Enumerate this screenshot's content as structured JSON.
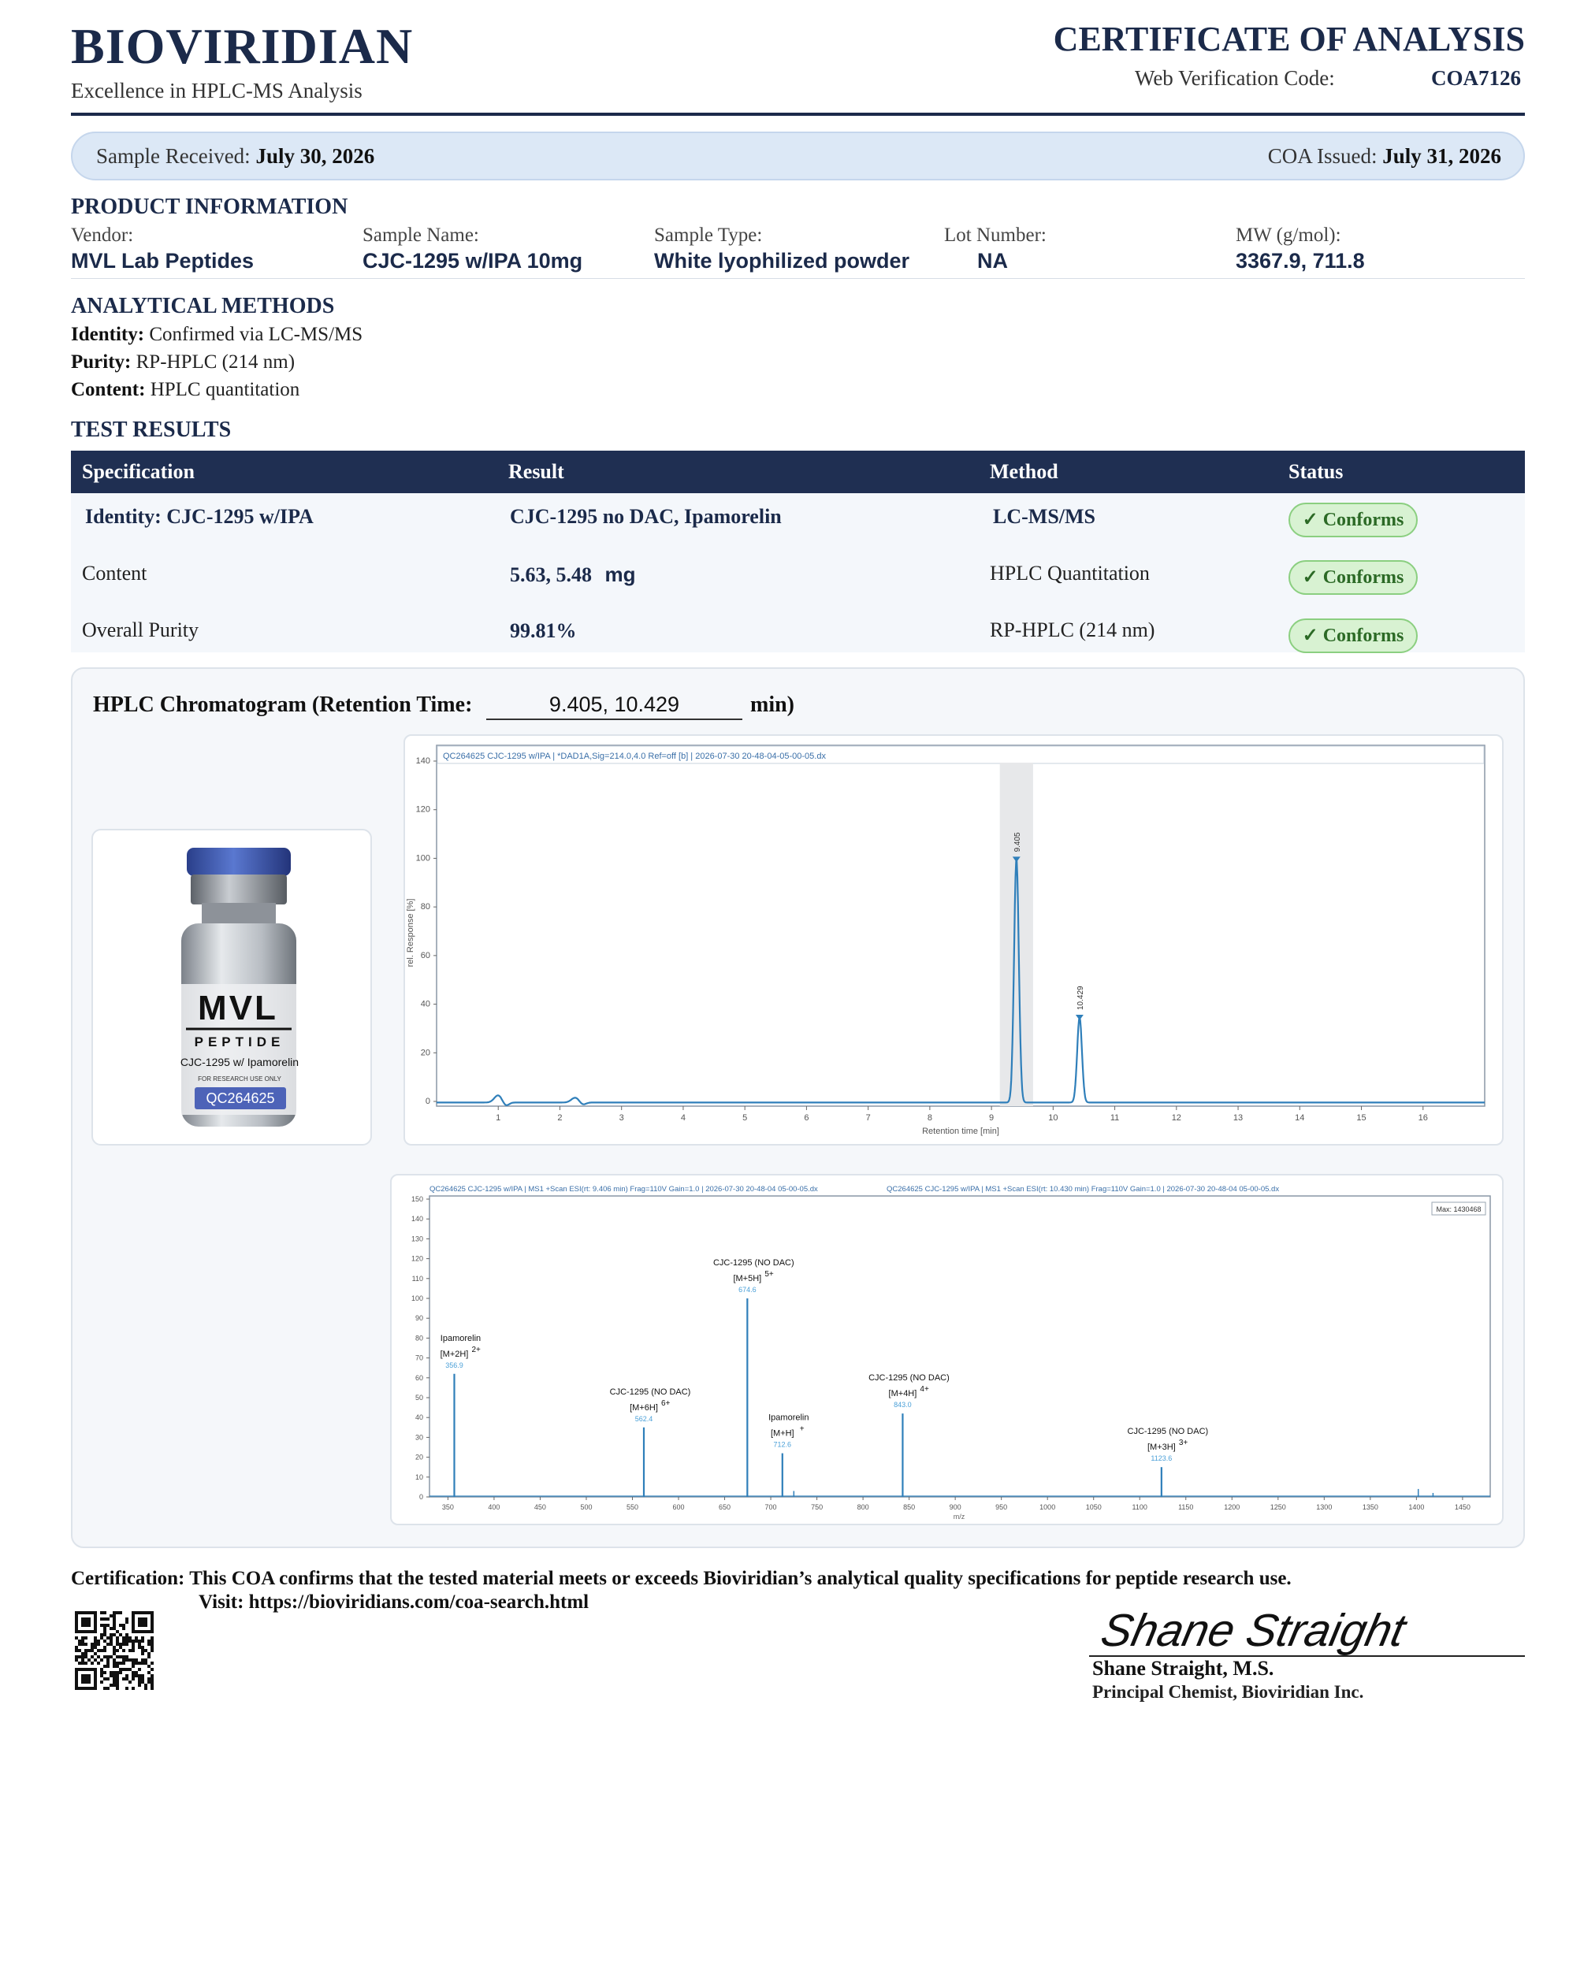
{
  "header": {
    "brand": "BIOVIRIDIAN",
    "tagline": "Excellence in HPLC-MS Analysis",
    "doc_title": "CERTIFICATE OF ANALYSIS",
    "verification_label": "Web Verification Code:",
    "verification_code": "COA7126"
  },
  "dates": {
    "received_label": "Sample Received:",
    "received_value": "July 30, 2026",
    "issued_label": "COA Issued:",
    "issued_value": "July 31, 2026"
  },
  "product_info": {
    "heading": "PRODUCT INFORMATION",
    "fields": [
      {
        "label": "Vendor:",
        "value": "MVL Lab Peptides"
      },
      {
        "label": "Sample Name:",
        "value": "CJC-1295 w/IPA 10mg"
      },
      {
        "label": "Sample Type:",
        "value": "White lyophilized powder"
      },
      {
        "label": "Lot Number:",
        "value": "NA"
      },
      {
        "label": "MW (g/mol):",
        "value": "3367.9, 711.8"
      }
    ]
  },
  "methods": {
    "heading": "ANALYTICAL METHODS",
    "items": [
      {
        "label": "Identity:",
        "value": "Confirmed via LC-MS/MS"
      },
      {
        "label": "Purity:",
        "value": "RP-HPLC (214 nm)"
      },
      {
        "label": "Content:",
        "value": "HPLC quantitation"
      }
    ]
  },
  "results": {
    "heading": "TEST RESULTS",
    "columns": [
      "Specification",
      "Result",
      "Method",
      "Status"
    ],
    "rows": [
      {
        "spec": "Identity:  CJC-1295 w/IPA",
        "result": "CJC-1295 no DAC, Ipamorelin",
        "unit": "",
        "method": "LC-MS/MS",
        "status": "✓ Conforms"
      },
      {
        "spec": "Content",
        "result": "5.63, 5.48",
        "unit": "mg",
        "method": "HPLC Quantitation",
        "status": "✓ Conforms"
      },
      {
        "spec": "Overall Purity",
        "result": "99.81%",
        "unit": "",
        "method": "RP-HPLC (214 nm)",
        "status": "✓ Conforms"
      }
    ]
  },
  "chromatogram": {
    "title": "HPLC Chromatogram (Retention Time:",
    "retention_time": "9.405, 10.429",
    "unit": "min)"
  },
  "vial": {
    "brand": "MVL",
    "sub": "PEPTIDE",
    "name": "CJC-1295 w/ Ipamorelin",
    "note": "FOR RESEARCH USE ONLY",
    "lot": "QC264625"
  },
  "hplc_plot": {
    "header": "QC264625 CJC-1295 w/IPA | *DAD1A,Sig=214.0,4.0 Ref=off [b] | 2026-07-30 20-48-04-05-00-05.dx",
    "ylabel": "rel. Response [%]",
    "xlabel": "Retention time [min]",
    "peak_labels": [
      "9.405",
      "10.429"
    ]
  },
  "ms_plot": {
    "header_left": "QC264625 CJC-1295 w/IPA | MS1 +Scan ESI(rt: 9.406 min) Frag=110V Gain=1.0 | 2026-07-30 20-48-04 05-00-05.dx",
    "header_right": "QC264625 CJC-1295 w/IPA | MS1 +Scan ESI(rt: 10.430 min) Frag=110V Gain=1.0 | 2026-07-30 20-48-04 05-00-05.dx",
    "max_label": "Max: 1430468",
    "xlabel": "m/z",
    "peaks": [
      {
        "name": "Ipamorelin",
        "ion": "[M+2H]",
        "charge": "2+",
        "mz_label": "356.9"
      },
      {
        "name": "CJC-1295 (NO DAC)",
        "ion": "[M+6H]",
        "charge": "6+",
        "mz_label": "562.4"
      },
      {
        "name": "CJC-1295 (NO DAC)",
        "ion": "[M+5H]",
        "charge": "5+",
        "mz_label": "674.6"
      },
      {
        "name": "Ipamorelin",
        "ion": "[M+H]",
        "charge": "+",
        "mz_label": "712.6"
      },
      {
        "name": "CJC-1295 (NO DAC)",
        "ion": "[M+4H]",
        "charge": "4+",
        "mz_label": "843.0"
      },
      {
        "name": "CJC-1295 (NO DAC)",
        "ion": "[M+3H]",
        "charge": "3+",
        "mz_label": "1123.6"
      }
    ]
  },
  "chart_data": [
    {
      "type": "line",
      "xlabel": "Retention time [min]",
      "ylabel": "rel. Response [%]",
      "xlim": [
        0,
        17
      ],
      "ylim": [
        0,
        140
      ],
      "xticks": [
        1,
        2,
        3,
        4,
        5,
        6,
        7,
        8,
        9,
        10,
        11,
        12,
        13,
        14,
        15,
        16
      ],
      "yticks": [
        0,
        20,
        40,
        60,
        80,
        100,
        120,
        140
      ],
      "peaks": [
        {
          "x": 9.405,
          "y": 100,
          "label": "9.405"
        },
        {
          "x": 10.429,
          "y": 35,
          "label": "10.429"
        }
      ],
      "minor_features": [
        {
          "x": 1.0,
          "y": 3
        },
        {
          "x": 2.25,
          "y": 2
        }
      ],
      "baseline": 1.5
    },
    {
      "type": "bar",
      "xlabel": "m/z",
      "xlim": [
        330,
        1480
      ],
      "ylim": [
        0,
        150
      ],
      "xticks": [
        350,
        400,
        450,
        500,
        550,
        600,
        650,
        700,
        750,
        800,
        850,
        900,
        950,
        1000,
        1050,
        1100,
        1150,
        1200,
        1250,
        1300,
        1350,
        1400,
        1450
      ],
      "yticks": [
        0,
        10,
        20,
        30,
        40,
        50,
        60,
        70,
        80,
        90,
        100,
        110,
        120,
        130,
        140,
        150
      ],
      "x": [
        356.9,
        562.4,
        674.6,
        712.6,
        843.0,
        1123.6
      ],
      "values": [
        62,
        35,
        100,
        22,
        42,
        15
      ]
    }
  ],
  "footer": {
    "certification_label": "Certification:",
    "certification_text": "This COA confirms that the tested material meets or exceeds Bioviridian’s analytical quality specifications for peptide research use.",
    "visit_text": "Visit: https://bioviridians.com/coa-search.html",
    "signature_script": "Shane Straight",
    "signer_name": "Shane Straight, M.S.",
    "signer_title": "Principal Chemist, Bioviridian Inc."
  }
}
